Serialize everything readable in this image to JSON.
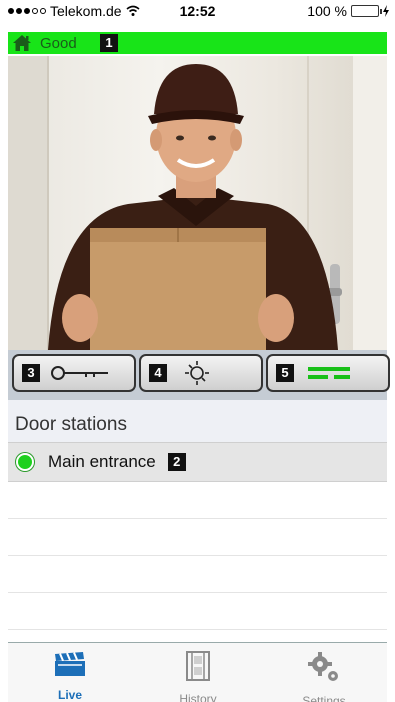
{
  "status_bar": {
    "carrier": "Telekom.de",
    "time": "12:52",
    "battery": "100 %"
  },
  "connection": {
    "status": "Good",
    "badge": "1",
    "color": "#18e418"
  },
  "controls": {
    "door_open_badge": "3",
    "light_badge": "4",
    "audio_badge": "5"
  },
  "door_stations": {
    "header": "Door stations",
    "items": [
      {
        "label": "Main entrance",
        "badge": "2",
        "status_color": "#1fd01f"
      }
    ]
  },
  "tabbar": {
    "tabs": [
      {
        "label": "Live",
        "icon": "clapperboard-icon",
        "active": true
      },
      {
        "label": "History",
        "icon": "film-strip-icon",
        "active": false
      },
      {
        "label": "Settings",
        "icon": "gears-icon",
        "active": false
      }
    ],
    "accent": "#1d6fb8"
  }
}
